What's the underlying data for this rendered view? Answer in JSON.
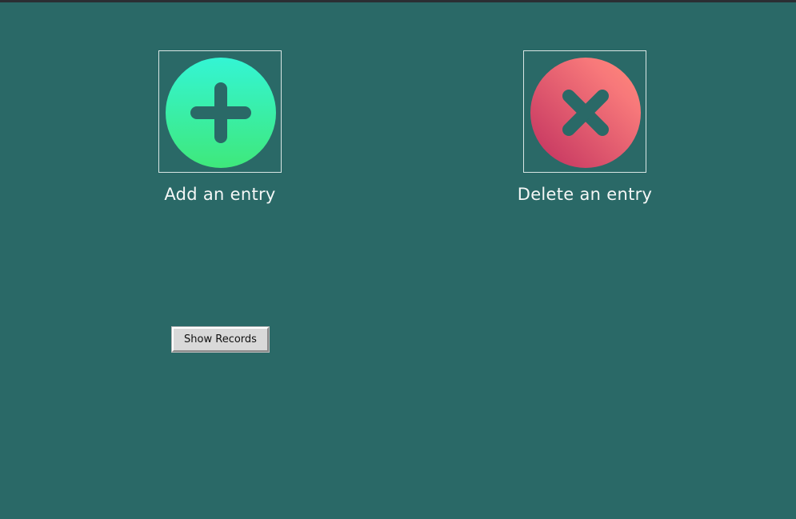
{
  "window": {
    "background": "#2a6967"
  },
  "actions": {
    "add": {
      "label": "Add an entry",
      "icon": "plus-icon",
      "gradient": [
        "#34f5d4",
        "#3fe87b"
      ]
    },
    "delete": {
      "label": "Delete an entry",
      "icon": "x-icon",
      "gradient": [
        "#ff8a78",
        "#c02f5e"
      ]
    }
  },
  "show_records": {
    "label": "Show Records"
  }
}
